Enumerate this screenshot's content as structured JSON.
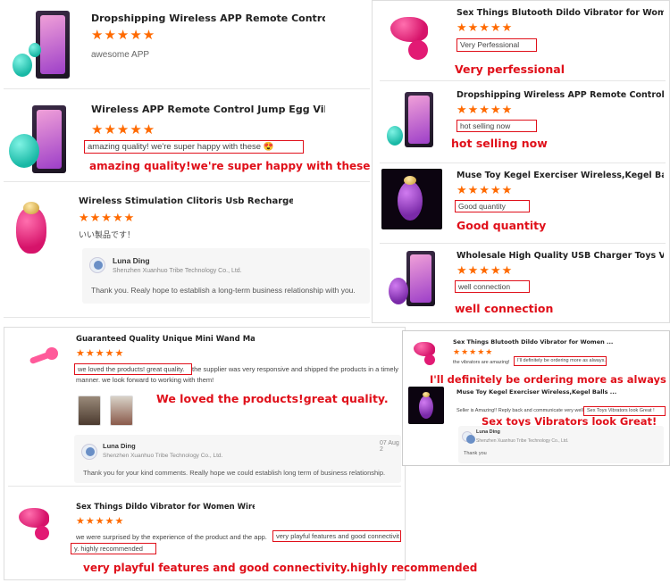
{
  "stars": "★★★★★",
  "left": {
    "card1": {
      "title": "Dropshipping Wireless APP Remote Control ke...",
      "review": "awesome APP"
    },
    "card2": {
      "title": "Wireless APP Remote Control Jump Egg Vibrat...",
      "review": "amazing quality! we're super happy with these 😍",
      "caption": "amazing quality!we're super happy with these"
    },
    "card3": {
      "title": "Wireless Stimulation Clitoris Usb Rechargeable...",
      "review": "いい製品です！",
      "reply": {
        "name": "Luna Ding",
        "company": "Shenzhen Xuanhuo Tribe Technology Co., Ltd.",
        "text": "Thank you. Realy hope to establish a long-term business relationship with you."
      }
    },
    "card4": {
      "title": "Guaranteed Quality Unique Mini Wand Massag...",
      "review_boxed": "we loved the products! great quality.",
      "review_rest": " the supplier was very responsive and shipped the products in a timely",
      "review_line2": "manner. we look forward to working with them!",
      "caption": "We loved the products!great quality.",
      "reply": {
        "name": "Luna Ding",
        "company": "Shenzhen Xuanhuo Tribe Technology Co., Ltd.",
        "date": "07 Aug 2",
        "text": "Thank you for your kind comments. Really hope we could establish long term of business relationship."
      }
    },
    "card5": {
      "title": "Sex Things Dildo Vibrator for Women Wireless ...",
      "review_pre": "we were surprised by the experience of the product and the app.",
      "review_boxed": " very playful features and good connectivit",
      "review_line2": "y. highly recommended",
      "caption": "very playful features and good connectivity.highly recommended"
    }
  },
  "right": {
    "card1": {
      "title": "Sex Things Blutooth Dildo Vibrator for Women ...",
      "review": "Very Perfessional",
      "caption": "Very perfessional"
    },
    "card2": {
      "title": "Dropshipping Wireless APP Remote Control ke...",
      "review": "hot selling now",
      "caption": "hot selling now"
    },
    "card3": {
      "title": "Muse Toy Kegel Exerciser Wireless,Kegel Balls ...",
      "review": "Good quantity",
      "caption": "Good quantity"
    },
    "card4": {
      "title": "Wholesale High Quality USB Charger Toys Vibr...",
      "review": "well connection",
      "caption": "well connection"
    }
  },
  "small": {
    "card1": {
      "title": "Sex Things Blutooth Dildo Vibrator for Women ...",
      "review_pre": "the vibrators are amazing!",
      "review_boxed": "I'll definitely be ordering more as always.",
      "caption": "I'll definitely be ordering more as always"
    },
    "card2": {
      "title": "Muse Toy Kegel Exerciser Wireless,Kegel Balls ...",
      "review_pre": "Seller is Amazing!! Reply back and communicate very well.",
      "review_boxed": "Sex Toys Vibrators look Great !",
      "caption": "Sex toys Vibrators look Great!",
      "reply": {
        "name": "Luna Ding",
        "company": "Shenzhen Xuanhuo Tribe Technology Co., Ltd.",
        "text": "Thank you"
      }
    }
  }
}
